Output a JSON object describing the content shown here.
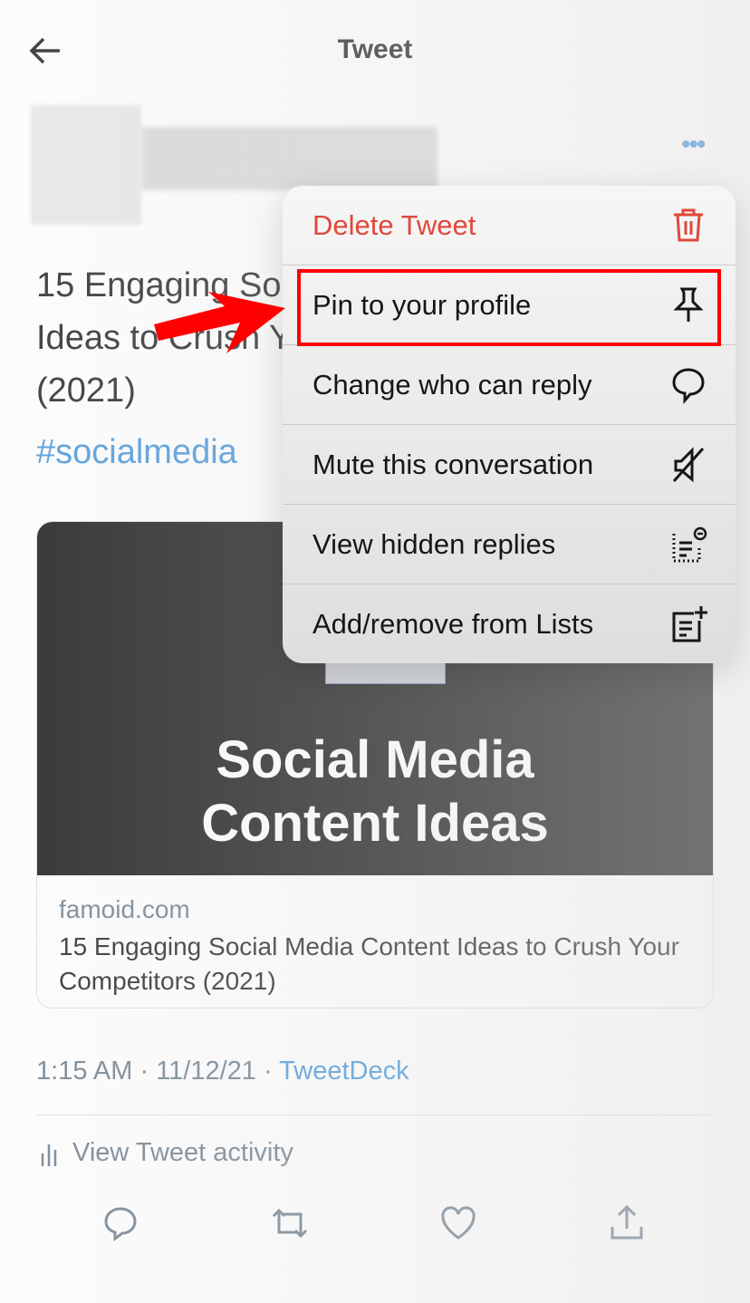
{
  "header": {
    "title": "Tweet"
  },
  "tweet": {
    "lines": [
      "15 Engaging Social Media Content",
      "Ideas to Crush Your Competitors",
      "(2021)"
    ],
    "hashtag": "#socialmedia",
    "card": {
      "image_text_1": "Social Media",
      "image_text_2": "Content Ideas",
      "domain": "famoid.com",
      "title": "15 Engaging Social Media Content Ideas to Crush Your Competitors (2021)"
    },
    "time": "1:15 AM",
    "date": "11/12/21",
    "source": "TweetDeck",
    "activity": "View Tweet activity"
  },
  "menu": {
    "items": [
      {
        "label": "Delete Tweet",
        "icon": "trash-icon",
        "color": "#e0483a"
      },
      {
        "label": "Pin to your profile",
        "icon": "pin-icon",
        "highlighted": true
      },
      {
        "label": "Change who can reply",
        "icon": "speech-bubble-icon"
      },
      {
        "label": "Mute this conversation",
        "icon": "mute-icon"
      },
      {
        "label": "View hidden replies",
        "icon": "hidden-replies-icon"
      },
      {
        "label": "Add/remove from Lists",
        "icon": "list-add-icon"
      }
    ]
  },
  "colors": {
    "accent": "#3b8fd8",
    "highlight": "#ff0000"
  }
}
